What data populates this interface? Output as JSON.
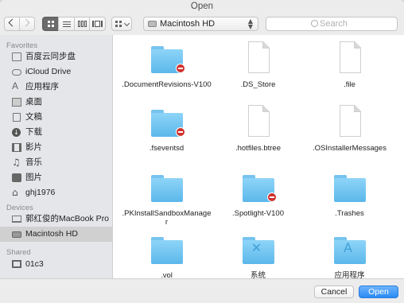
{
  "window": {
    "title": "Open"
  },
  "toolbar": {
    "location": "Macintosh HD",
    "search_placeholder": "Search"
  },
  "sidebar": {
    "favorites_header": "Favorites",
    "favorites": [
      {
        "label": "百度云同步盘",
        "icon": "folder-icon"
      },
      {
        "label": "iCloud Drive",
        "icon": "cloud-icon"
      },
      {
        "label": "应用程序",
        "icon": "applications-icon"
      },
      {
        "label": "桌面",
        "icon": "desktop-icon"
      },
      {
        "label": "文稿",
        "icon": "documents-icon"
      },
      {
        "label": "下载",
        "icon": "downloads-icon"
      },
      {
        "label": "影片",
        "icon": "movies-icon"
      },
      {
        "label": "音乐",
        "icon": "music-icon"
      },
      {
        "label": "图片",
        "icon": "pictures-icon"
      },
      {
        "label": "ghj1976",
        "icon": "home-icon"
      }
    ],
    "devices_header": "Devices",
    "devices": [
      {
        "label": "郭红俊的MacBook Pro",
        "icon": "laptop-icon"
      },
      {
        "label": "Macintosh HD",
        "icon": "disk-icon",
        "selected": true
      }
    ],
    "shared_header": "Shared",
    "shared": [
      {
        "label": "01c3",
        "icon": "monitor-icon"
      }
    ]
  },
  "files": [
    {
      "name": ".DocumentRevisions-V100",
      "type": "folder",
      "badge": true
    },
    {
      "name": ".DS_Store",
      "type": "document"
    },
    {
      "name": ".file",
      "type": "document"
    },
    {
      "name": ".fseventsd",
      "type": "folder",
      "badge": true
    },
    {
      "name": ".hotfiles.btree",
      "type": "document"
    },
    {
      "name": ".OSInstallerMessages",
      "type": "document"
    },
    {
      "name": ".PKInstallSandboxManager",
      "type": "folder"
    },
    {
      "name": ".Spotlight-V100",
      "type": "folder",
      "badge": true
    },
    {
      "name": ".Trashes",
      "type": "folder"
    },
    {
      "name": ".vol",
      "type": "folder"
    },
    {
      "name": "系统",
      "type": "folder",
      "emblem": "x"
    },
    {
      "name": "应用程序",
      "type": "folder",
      "emblem": "a"
    }
  ],
  "buttons": {
    "cancel": "Cancel",
    "open": "Open"
  },
  "colors": {
    "accent": "#2a8bf4",
    "folder": "#5bb8ea",
    "badge": "#d0302c"
  }
}
